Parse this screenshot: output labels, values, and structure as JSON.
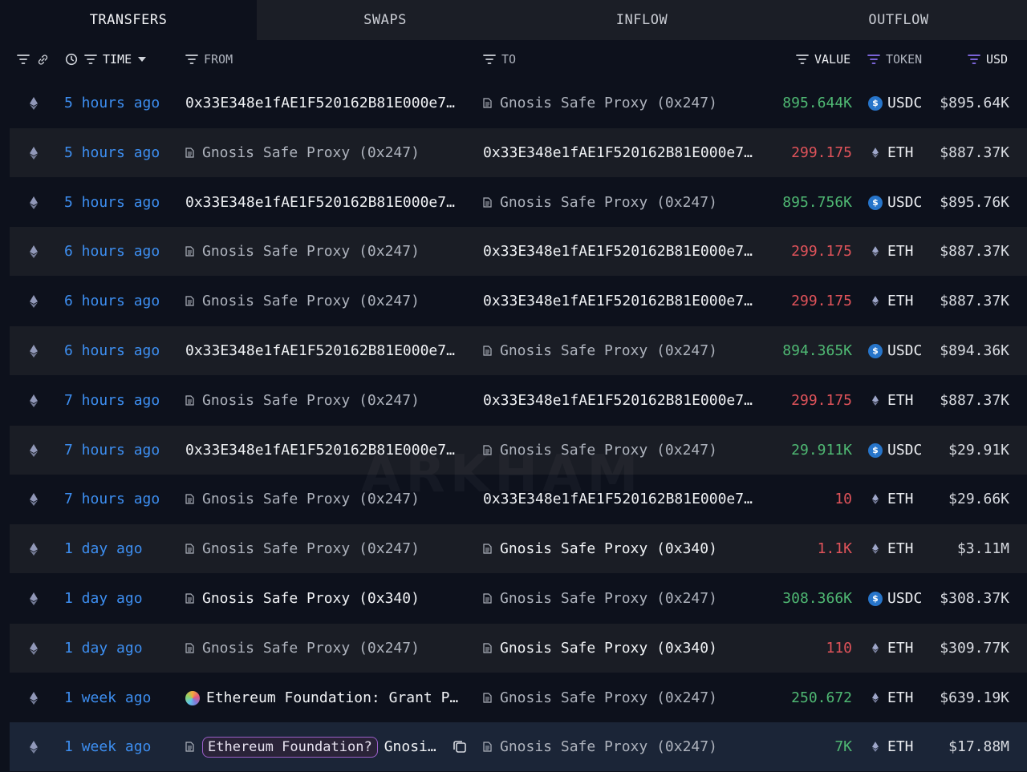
{
  "tabs": [
    {
      "label": "TRANSFERS",
      "active": true
    },
    {
      "label": "SWAPS",
      "active": false
    },
    {
      "label": "INFLOW",
      "active": false
    },
    {
      "label": "OUTFLOW",
      "active": false
    }
  ],
  "columns": {
    "time": "TIME",
    "from": "FROM",
    "to": "TO",
    "value": "VALUE",
    "token": "TOKEN",
    "usd": "USD"
  },
  "colors": {
    "positive": "#4fb873",
    "negative": "#e0535a",
    "time_link": "#3d8ef0",
    "filter_active": "#8a6ff0"
  },
  "watermark": "ARKHAM",
  "rows": [
    {
      "time": "5 hours ago",
      "from": "0x33E348e1fAE1F520162B81E000e7…",
      "from_kind": "address",
      "to": "Gnosis Safe Proxy (0x247)",
      "to_kind": "entity-dim",
      "value": "895.644K",
      "value_sign": "positive",
      "token": "USDC",
      "usd": "$895.64K"
    },
    {
      "time": "5 hours ago",
      "from": "Gnosis Safe Proxy (0x247)",
      "from_kind": "entity-dim",
      "to": "0x33E348e1fAE1F520162B81E000e7…",
      "to_kind": "address",
      "value": "299.175",
      "value_sign": "negative",
      "token": "ETH",
      "usd": "$887.37K"
    },
    {
      "time": "5 hours ago",
      "from": "0x33E348e1fAE1F520162B81E000e7…",
      "from_kind": "address",
      "to": "Gnosis Safe Proxy (0x247)",
      "to_kind": "entity-dim",
      "value": "895.756K",
      "value_sign": "positive",
      "token": "USDC",
      "usd": "$895.76K"
    },
    {
      "time": "6 hours ago",
      "from": "Gnosis Safe Proxy (0x247)",
      "from_kind": "entity-dim",
      "to": "0x33E348e1fAE1F520162B81E000e7…",
      "to_kind": "address",
      "value": "299.175",
      "value_sign": "negative",
      "token": "ETH",
      "usd": "$887.37K"
    },
    {
      "time": "6 hours ago",
      "from": "Gnosis Safe Proxy (0x247)",
      "from_kind": "entity-dim",
      "to": "0x33E348e1fAE1F520162B81E000e7…",
      "to_kind": "address",
      "value": "299.175",
      "value_sign": "negative",
      "token": "ETH",
      "usd": "$887.37K"
    },
    {
      "time": "6 hours ago",
      "from": "0x33E348e1fAE1F520162B81E000e7…",
      "from_kind": "address",
      "to": "Gnosis Safe Proxy (0x247)",
      "to_kind": "entity-dim",
      "value": "894.365K",
      "value_sign": "positive",
      "token": "USDC",
      "usd": "$894.36K"
    },
    {
      "time": "7 hours ago",
      "from": "Gnosis Safe Proxy (0x247)",
      "from_kind": "entity-dim",
      "to": "0x33E348e1fAE1F520162B81E000e7…",
      "to_kind": "address",
      "value": "299.175",
      "value_sign": "negative",
      "token": "ETH",
      "usd": "$887.37K"
    },
    {
      "time": "7 hours ago",
      "from": "0x33E348e1fAE1F520162B81E000e7…",
      "from_kind": "address",
      "to": "Gnosis Safe Proxy (0x247)",
      "to_kind": "entity-dim",
      "value": "29.911K",
      "value_sign": "positive",
      "token": "USDC",
      "usd": "$29.91K"
    },
    {
      "time": "7 hours ago",
      "from": "Gnosis Safe Proxy (0x247)",
      "from_kind": "entity-dim",
      "to": "0x33E348e1fAE1F520162B81E000e7…",
      "to_kind": "address",
      "value": "10",
      "value_sign": "negative",
      "token": "ETH",
      "usd": "$29.66K"
    },
    {
      "time": "1 day ago",
      "from": "Gnosis Safe Proxy (0x247)",
      "from_kind": "entity-dim",
      "to": "Gnosis Safe Proxy (0x340)",
      "to_kind": "entity-bright",
      "value": "1.1K",
      "value_sign": "negative",
      "token": "ETH",
      "usd": "$3.11M"
    },
    {
      "time": "1 day ago",
      "from": "Gnosis Safe Proxy (0x340)",
      "from_kind": "entity-bright",
      "to": "Gnosis Safe Proxy (0x247)",
      "to_kind": "entity-dim",
      "value": "308.366K",
      "value_sign": "positive",
      "token": "USDC",
      "usd": "$308.37K"
    },
    {
      "time": "1 day ago",
      "from": "Gnosis Safe Proxy (0x247)",
      "from_kind": "entity-dim",
      "to": "Gnosis Safe Proxy (0x340)",
      "to_kind": "entity-bright",
      "value": "110",
      "value_sign": "negative",
      "token": "ETH",
      "usd": "$309.77K"
    },
    {
      "time": "1 week ago",
      "from": "Ethereum Foundation: Grant P…",
      "from_kind": "ef",
      "to": "Gnosis Safe Proxy (0x247)",
      "to_kind": "entity-dim",
      "value": "250.672",
      "value_sign": "positive",
      "token": "ETH",
      "usd": "$639.19K"
    },
    {
      "time": "1 week ago",
      "from_pill": "Ethereum Foundation?",
      "from": "Gnosi…",
      "from_kind": "pill",
      "to": "Gnosis Safe Proxy (0x247)",
      "to_kind": "entity-dim",
      "value": "7K",
      "value_sign": "positive",
      "token": "ETH",
      "usd": "$17.88M"
    }
  ]
}
